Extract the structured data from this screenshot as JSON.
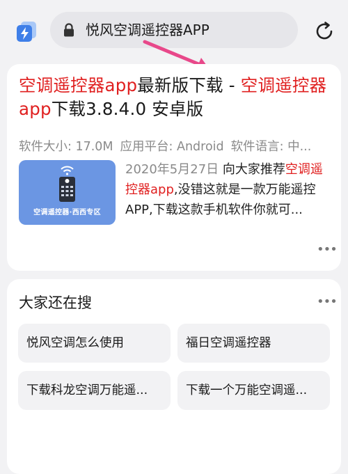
{
  "header": {
    "search_query": "悦风空调遥控器APP",
    "icons": {
      "logo": "app-logo-icon",
      "lock": "lock-icon",
      "refresh": "refresh-icon"
    },
    "accent_color": "#3f7fe8"
  },
  "result": {
    "title_parts": [
      "空调遥控器app",
      "最新版下载 - ",
      "空调遥控器app",
      "下载3.8.4.0 安卓版"
    ],
    "meta": {
      "size": "软件大小: 17.0M",
      "platform": "应用平台: Android",
      "language": "软件语言: 中..."
    },
    "thumbnail_caption": "空调遥控器·西西专区",
    "snippet_date": "2020年5月27日",
    "snippet_parts": [
      " 向大家推荐",
      "空调遥控器app",
      ",没错这就是一款万能遥控APP,下载这款手机软件你就可..."
    ],
    "more_label": "•••",
    "highlight_color": "#e02020"
  },
  "related": {
    "title": "大家还在搜",
    "more_label": "•••",
    "items": [
      "悦风空调怎么使用",
      "福日空调遥控器",
      "下载科龙空调万能遥...",
      "下载一个万能空调遥..."
    ]
  }
}
